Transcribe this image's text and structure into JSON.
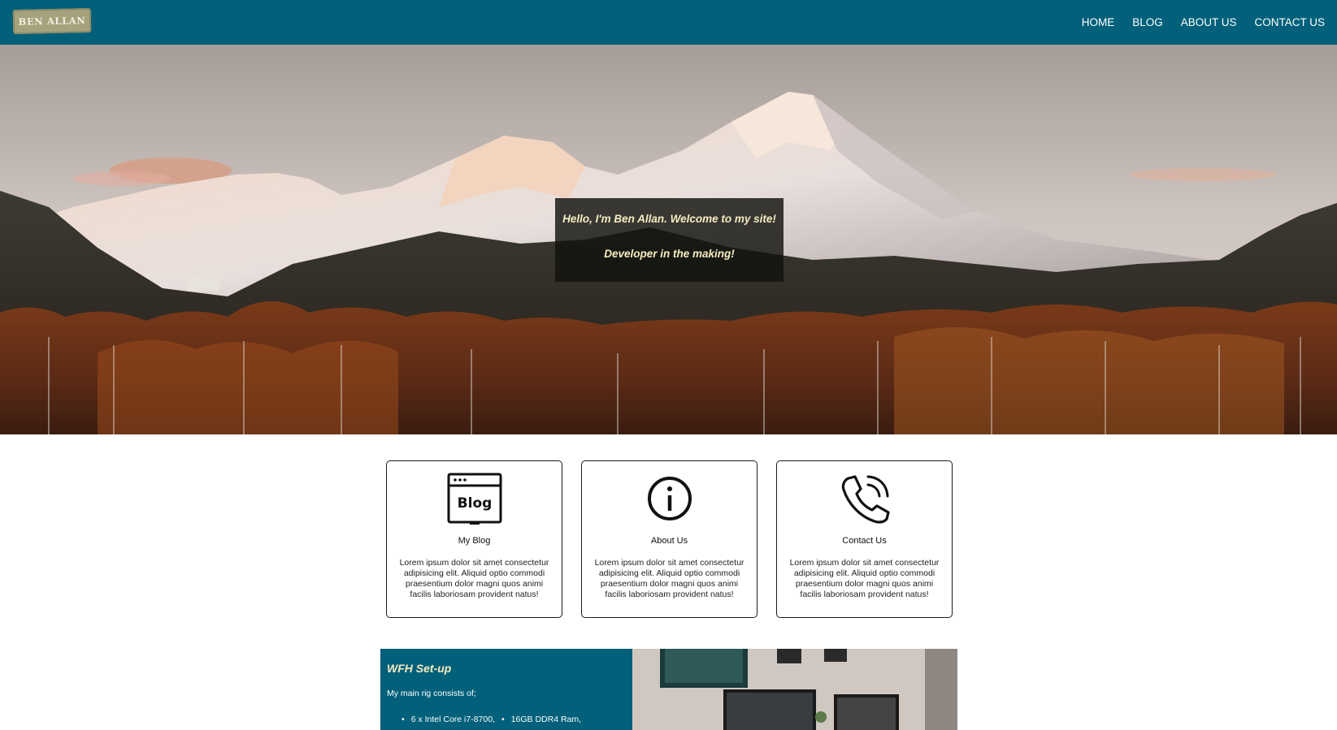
{
  "nav": {
    "logo_text": "BEN ALLAN",
    "links": [
      "HOME",
      "BLOG",
      "ABOUT US",
      "CONTACT US"
    ]
  },
  "hero": {
    "line1": "Hello, I'm Ben Allan. Welcome to my site!",
    "line2": "Developer in the making!"
  },
  "cards": [
    {
      "icon": "blog-window-icon",
      "icon_text": "Blog",
      "title": "My Blog",
      "text": "Lorem ipsum dolor sit amet consectetur adipisicing elit. Aliquid optio commodi praesentium dolor magni quos animi facilis laboriosam provident natus!"
    },
    {
      "icon": "info-icon",
      "title": "About Us",
      "text": "Lorem ipsum dolor sit amet consectetur adipisicing elit. Aliquid optio commodi praesentium dolor magni quos animi facilis laboriosam provident natus!"
    },
    {
      "icon": "phone-icon",
      "title": "Contact Us",
      "text": "Lorem ipsum dolor sit amet consectetur adipisicing elit. Aliquid optio commodi praesentium dolor magni quos animi facilis laboriosam provident natus!"
    }
  ],
  "wfh": {
    "title": "WFH Set-up",
    "intro": "My main rig consists of;",
    "items": [
      "6 x Intel Core i7-8700,",
      "16GB DDR4 Ram,"
    ]
  },
  "colors": {
    "nav_bg": "#02607a",
    "hero_text": "#f5ecc0",
    "logo_bg": "#a6a27e"
  }
}
